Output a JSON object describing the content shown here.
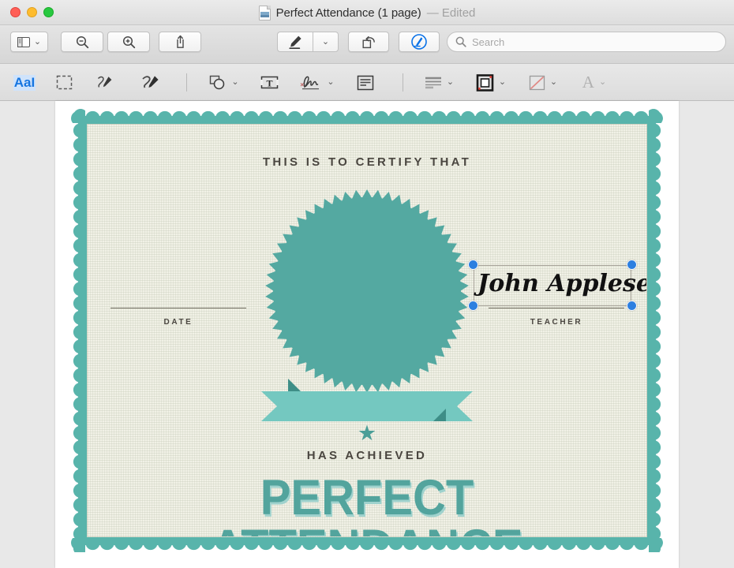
{
  "window": {
    "title": "Perfect Attendance (1 page)",
    "edited_suffix": "— Edited",
    "doc_icon": "document-icon",
    "traffic_lights": [
      "close-button",
      "minimize-button",
      "zoom-button"
    ]
  },
  "toolbar": {
    "sidebar_label": "sidebar-view",
    "sidebar_chevron": "⌄",
    "zoom_out_label": "zoom-out",
    "zoom_in_label": "zoom-in",
    "share_label": "share",
    "markup_pen_label": "markup-pen",
    "markup_pen_chevron": "⌄",
    "rotate_label": "rotate-left",
    "markup_toggle_label": "show-markup-toolbar",
    "search": {
      "placeholder": "Search",
      "value": "",
      "icon": "search-icon"
    }
  },
  "markupbar": {
    "items": [
      {
        "name": "text-selection-tool",
        "glyph": "AaI",
        "active": true
      },
      {
        "name": "rectangular-selection-tool",
        "glyph": "dashed-rect"
      },
      {
        "name": "sketch-tool",
        "glyph": "sketch"
      },
      {
        "name": "draw-tool",
        "glyph": "draw"
      },
      {
        "name": "shapes-tool",
        "glyph": "shapes",
        "chevron": "⌄"
      },
      {
        "name": "text-tool",
        "glyph": "T"
      },
      {
        "name": "sign-tool",
        "glyph": "signature",
        "chevron": "⌄"
      },
      {
        "name": "note-tool",
        "glyph": "note"
      },
      {
        "name": "shape-style-tool",
        "glyph": "lines",
        "chevron": "⌄"
      },
      {
        "name": "border-color-tool",
        "glyph": "border-square",
        "chevron": "⌄"
      },
      {
        "name": "fill-color-tool",
        "glyph": "fill-none",
        "chevron": "⌄"
      },
      {
        "name": "text-style-tool",
        "glyph": "A",
        "chevron": "⌄",
        "disabled": true
      }
    ]
  },
  "certificate": {
    "header": "THIS IS TO CERTIFY THAT",
    "achieved": "HAS ACHIEVED",
    "title": "PERFECT ATTENDANCE",
    "star": "★",
    "date_label": "DATE",
    "teacher_label": "TEACHER",
    "signature_value": "John Appleseed",
    "colors": {
      "border_teal": "#58b4ab",
      "seal_teal": "#54a9a1",
      "ribbon_light": "#74c8c0",
      "ribbon_dark": "#4d9e96",
      "paper": "#f1f1e6",
      "title_teal": "#53a49d",
      "title_shadow": "#9fd2cd",
      "ink": "#4a4640",
      "handle_blue": "#2d7fe0"
    }
  }
}
